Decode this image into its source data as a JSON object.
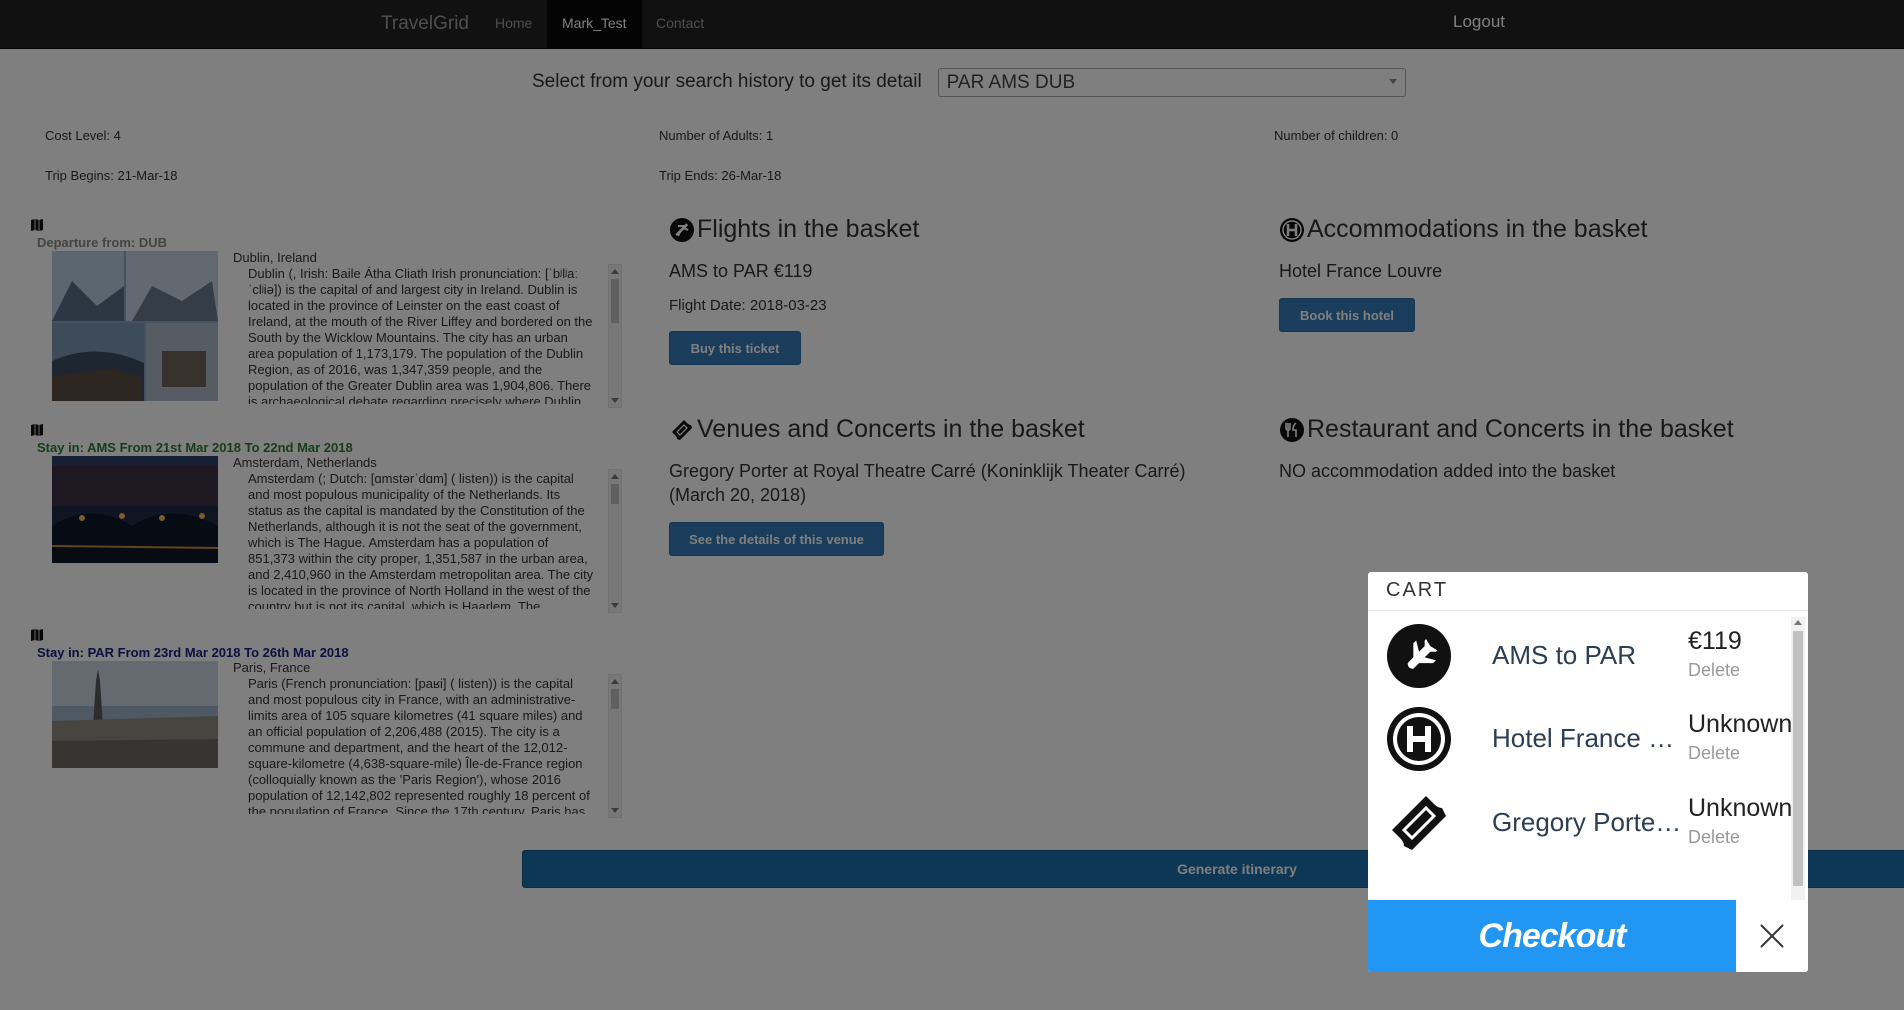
{
  "navbar": {
    "brand": "TravelGrid",
    "links": [
      "Home",
      "Mark_Test",
      "Contact"
    ],
    "logout": "Logout"
  },
  "history": {
    "label": "Select from your search history to get its detail",
    "selected": "PAR AMS DUB"
  },
  "trip": {
    "cost_level": "Cost Level: 4",
    "adults": "Number of Adults: 1",
    "children": "Number of children: 0",
    "begins": "Trip Begins: 21-Mar-18",
    "ends": "Trip Ends: 26-Mar-18"
  },
  "destinations": [
    {
      "title": "Departure from: DUB",
      "title_color": "#888888",
      "place": "Dublin, Ireland",
      "description": "Dublin (, Irish: Baile Átha Cliath Irish pronunciation: [ˈbʲlʲaː ˈclʲiə]) is the capital of and largest city in Ireland. Dublin is located in the province of Leinster on the east coast of Ireland, at the mouth of the River Liffey and bordered on the South by the Wicklow Mountains. The city has an urban area population of 1,173,179. The population of the Dublin Region, as of 2016, was 1,347,359 people, and the population of the Greater Dublin area was 1,904,806. There is archaeological debate regarding precisely where Dublin..."
    },
    {
      "title": "Stay in: AMS From 21st Mar 2018 To 22nd Mar 2018",
      "title_color": "#2e7d32",
      "place": "Amsterdam, Netherlands",
      "description": "Amsterdam (; Dutch: [ɑmstərˈdɑm] ( listen)) is the capital and most populous municipality of the Netherlands. Its status as the capital is mandated by the Constitution of the Netherlands, although it is not the seat of the government, which is The Hague. Amsterdam has a population of 851,373 within the city proper, 1,351,587 in the urban area, and 2,410,960 in the Amsterdam metropolitan area. The city is located in the province of North Holland in the west of the country but is not its capital, which is Haarlem. The metropolitan..."
    },
    {
      "title": "Stay in: PAR From 23rd Mar 2018 To 26th Mar 2018",
      "title_color": "#1a237e",
      "place": "Paris, France",
      "description": "Paris (French pronunciation: [paʁi] ( listen)) is the capital and most populous city in France, with an administrative-limits area of 105 square kilometres (41 square miles) and an official population of 2,206,488 (2015). The city is a commune and department, and the heart of the 12,012-square-kilometre (4,638-square-mile) Île-de-France region (colloquially known as the 'Paris Region'), whose 2016 population of 12,142,802 represented roughly 18 percent of the population of France. Since the 17th century, Paris has been one of..."
    }
  ],
  "flights": {
    "title": "Flights in the basket",
    "route": "AMS to PAR €119",
    "date": "Flight Date: 2018-03-23",
    "button": "Buy this ticket"
  },
  "accommodations": {
    "title": "Accommodations in the basket",
    "hotel": "Hotel France Louvre",
    "button": "Book this hotel"
  },
  "venues": {
    "title": "Venues and Concerts in the basket",
    "line1": "Gregory Porter at Royal Theatre Carré (Koninklijk Theater Carré)",
    "line2": "(March 20, 2018)",
    "button": "See the details of this venue"
  },
  "restaurants": {
    "title": "Restaurant and Concerts in the basket",
    "text": "NO accommodation added into the basket"
  },
  "generate_button": "Generate itinerary",
  "cart": {
    "header": "CART",
    "items": [
      {
        "icon": "airplane-icon",
        "name": "AMS to PAR",
        "price": "€119",
        "delete": "Delete"
      },
      {
        "icon": "hotel-icon",
        "name": "Hotel France Louvre",
        "price": "Unknown",
        "delete": "Delete"
      },
      {
        "icon": "ticket-icon",
        "name": "Gregory Porter at Royal Theatre Carré",
        "price": "Unknown",
        "delete": "Delete"
      }
    ],
    "checkout": "Checkout"
  },
  "colors": {
    "primary_button": "#337ab7",
    "checkout": "#2196f3",
    "navbar": "#222222"
  }
}
